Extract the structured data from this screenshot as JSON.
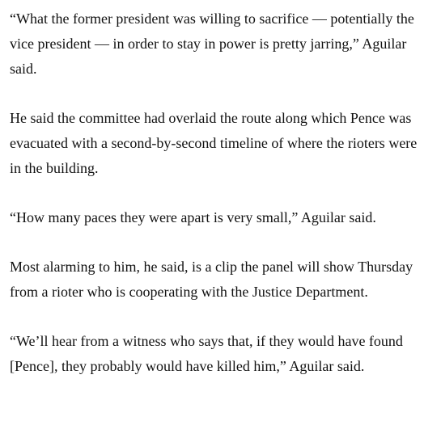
{
  "article": {
    "paragraphs": [
      "“What the former president was willing to sacrifice — potentially the vice president — in order to stay in power is pretty jarring,” Aguilar said.",
      "He said the committee had overlaid the route along which Pence was evacuated with a second-by-second timeline of where the rioters were in the building.",
      "“How many paces they were apart is very small,” Aguilar said.",
      "Most alarming to him, he said, is a clip the panel will show Thursday from a rioter who is cooperating with the Justice Department.",
      "“We’ll hear from a witness who says that, if they would have found [Pence], they probably would have killed him,” Aguilar said."
    ]
  }
}
